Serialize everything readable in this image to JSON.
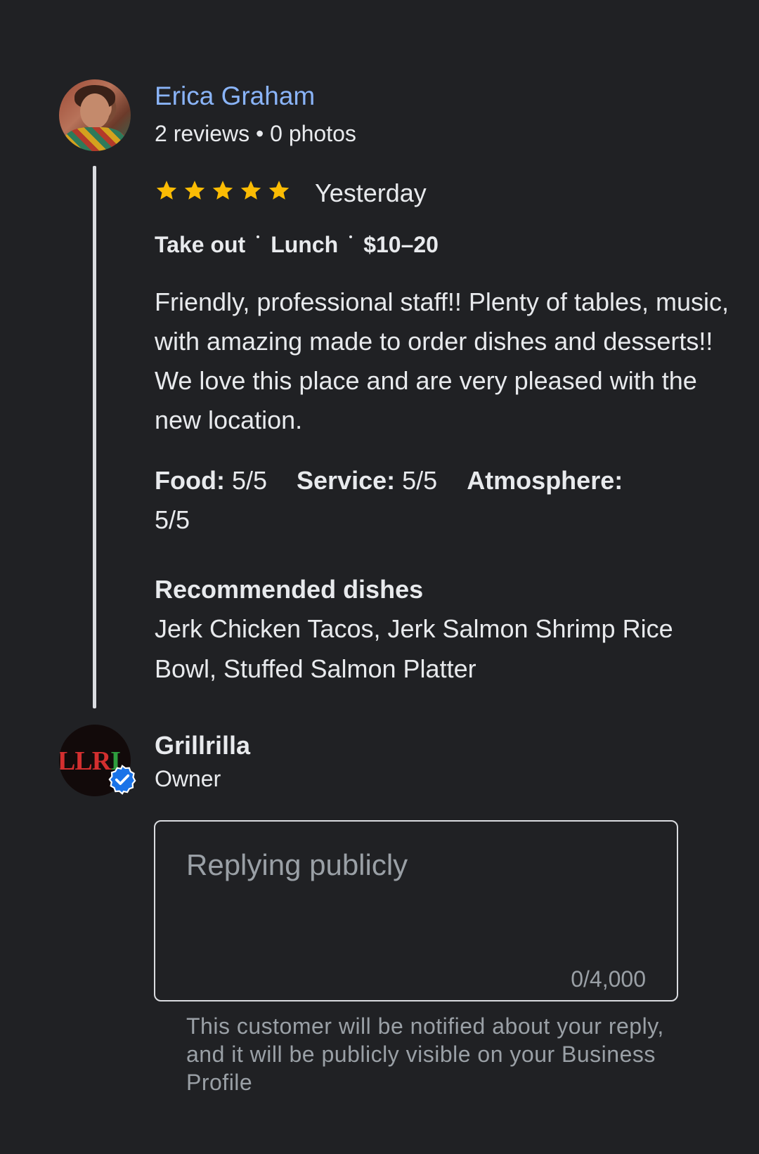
{
  "review": {
    "reviewer": {
      "name": "Erica Graham",
      "meta": "2 reviews • 0 photos"
    },
    "rating": 5,
    "rating_max": 5,
    "date": "Yesterday",
    "tags": [
      "Take out",
      "Lunch",
      "$10–20"
    ],
    "text": "Friendly, professional staff!! Plenty of tables, music, with amazing made to order dishes and desserts!! We love this place and are very pleased with the new location.",
    "ratings": {
      "food_label": "Food:",
      "food_value": "5/5",
      "service_label": "Service:",
      "service_value": "5/5",
      "atmosphere_label": "Atmosphere:",
      "atmosphere_value": "5/5"
    },
    "recommended": {
      "title": "Recommended dishes",
      "list": "Jerk Chicken Tacos, Jerk Salmon Shrimp Rice Bowl, Stuffed Salmon Platter"
    }
  },
  "owner": {
    "name": "Grillrilla",
    "role": "Owner",
    "logo_text_red": "LLR",
    "logo_text_green": "I"
  },
  "reply": {
    "placeholder": "Replying publicly",
    "value": "",
    "char_count": "0/4,000",
    "helper": "This customer will be notified about your reply, and it will be publicly visible on your Business Profile"
  },
  "colors": {
    "background": "#202124",
    "link": "#8ab4f8",
    "star": "#fbbc04",
    "verified": "#1a73e8"
  },
  "icons": {
    "star": "star-icon",
    "verified": "verified-badge-icon"
  }
}
